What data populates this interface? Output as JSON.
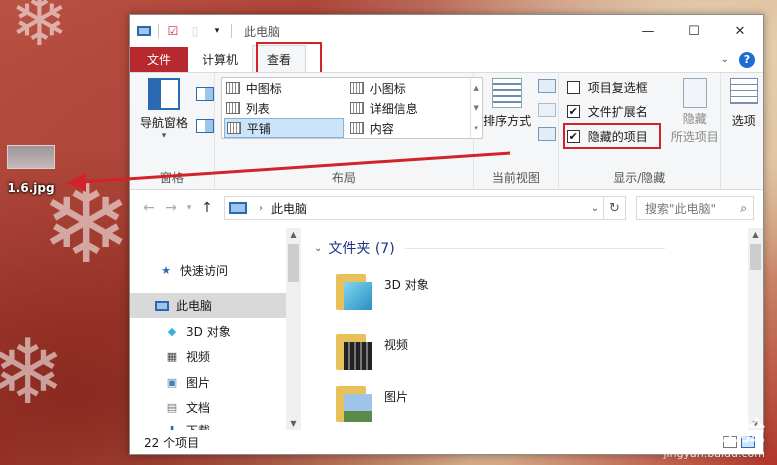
{
  "desktop": {
    "file_label": "1.6.jpg"
  },
  "window": {
    "title": "此电脑",
    "controls": {
      "minimize": "—",
      "maximize": "☐",
      "close": "✕"
    }
  },
  "tabs": {
    "file": "文件",
    "computer": "计算机",
    "view": "查看",
    "help": "?"
  },
  "ribbon": {
    "pane": {
      "nav_pane": "导航窗格",
      "label": "窗格"
    },
    "layout": {
      "label": "布局",
      "items": [
        "中图标",
        "小图标",
        "列表",
        "详细信息",
        "平铺",
        "内容"
      ]
    },
    "current_view": {
      "sort": "排序方式",
      "label": "当前视图"
    },
    "show_hide": {
      "label": "显示/隐藏",
      "item_checkboxes": "项目复选框",
      "file_extensions": "文件扩展名",
      "hidden_items": "隐藏的项目",
      "hide_selected_line1": "隐藏",
      "hide_selected_line2": "所选项目"
    },
    "options": {
      "label": "选项"
    }
  },
  "address": {
    "path": "此电脑",
    "search_placeholder": "搜索\"此电脑\""
  },
  "nav": {
    "quick_access": "快速访问",
    "this_pc": "此电脑",
    "items": [
      "3D 对象",
      "视频",
      "图片",
      "文档",
      "下载"
    ]
  },
  "main": {
    "group_header": "文件夹 (7)",
    "folders": [
      "3D 对象",
      "视频",
      "图片"
    ]
  },
  "status": {
    "count": "22 个项目"
  },
  "watermark": {
    "brand": "Baidu 经验",
    "url": "jingyan.baidu.com"
  },
  "colors": {
    "file_tab": "#b7292e",
    "highlight_red": "#d2232a",
    "accent": "#2a6ab3"
  }
}
